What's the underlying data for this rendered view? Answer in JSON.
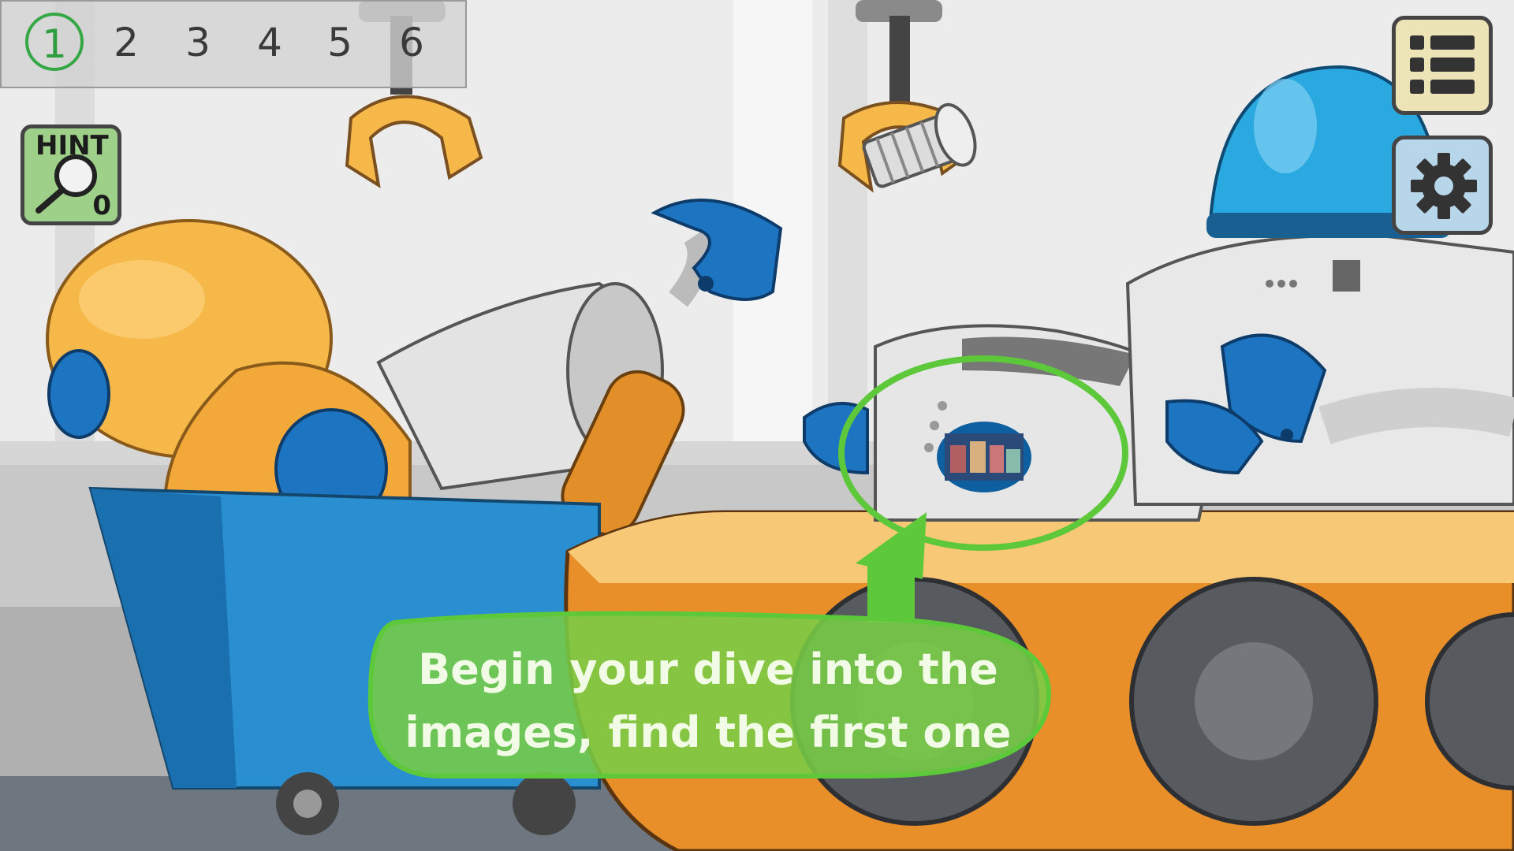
{
  "levels": {
    "items": [
      "1",
      "2",
      "3",
      "4",
      "5",
      "6"
    ],
    "current": "1"
  },
  "hint": {
    "label": "HINT",
    "count": "0"
  },
  "buttons": {
    "menu_icon": "list-menu-icon",
    "settings_icon": "gear-icon"
  },
  "tutorial": {
    "line1": "Begin your dive into the",
    "line2": "images, find the first one"
  },
  "colors": {
    "accent_green": "#5cc83a",
    "active_level": "#2e9e3e",
    "hint_bg": "#9ed08a",
    "menu_bg": "#ece3b6",
    "settings_bg": "#b8d6ea"
  }
}
